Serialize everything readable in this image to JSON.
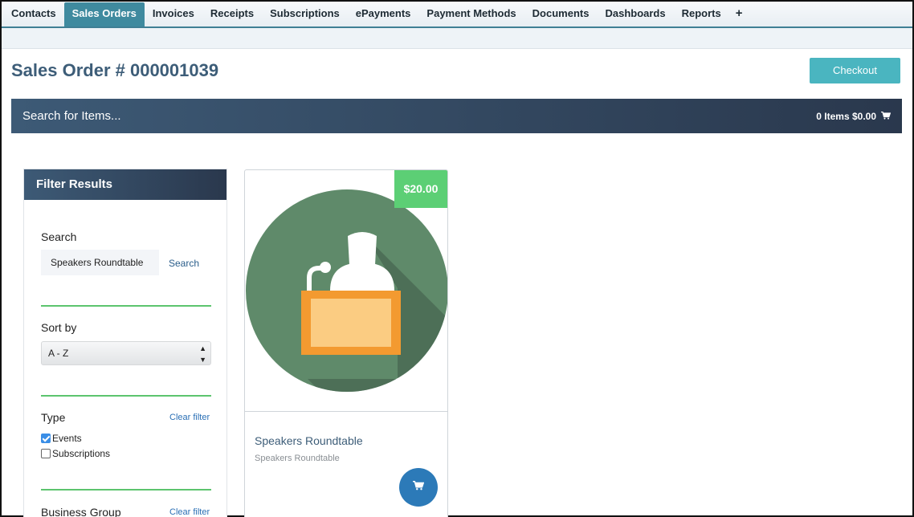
{
  "nav": {
    "tabs": [
      {
        "label": "Contacts"
      },
      {
        "label": "Sales Orders",
        "active": true
      },
      {
        "label": "Invoices"
      },
      {
        "label": "Receipts"
      },
      {
        "label": "Subscriptions"
      },
      {
        "label": "ePayments"
      },
      {
        "label": "Payment Methods"
      },
      {
        "label": "Documents"
      },
      {
        "label": "Dashboards"
      },
      {
        "label": "Reports"
      }
    ],
    "add_label": "+",
    "active_color": "#3f8a9f"
  },
  "page": {
    "title": "Sales Order # 000001039",
    "checkout_label": "Checkout"
  },
  "search_bar": {
    "placeholder": "Search for Items...",
    "cart_summary": "0 Items $0.00",
    "cart_icon": "cart-icon"
  },
  "filter": {
    "header": "Filter Results",
    "search_label": "Search",
    "search_value": "Speakers Roundtable",
    "search_button": "Search",
    "sort_label": "Sort by",
    "sort_value": "A - Z",
    "type_label": "Type",
    "clear_filter": "Clear filter",
    "type_options": [
      {
        "label": "Events",
        "checked": true
      },
      {
        "label": "Subscriptions",
        "checked": false
      }
    ],
    "business_group_label": "Business Group",
    "divider_color": "#5cc46e"
  },
  "products": [
    {
      "title": "Speakers Roundtable",
      "subtitle": "Speakers Roundtable",
      "price": "$20.00",
      "image_icon": "speaker-podium-icon",
      "price_color": "#5ccf75",
      "cart_button_color": "#2c7ab8"
    }
  ]
}
